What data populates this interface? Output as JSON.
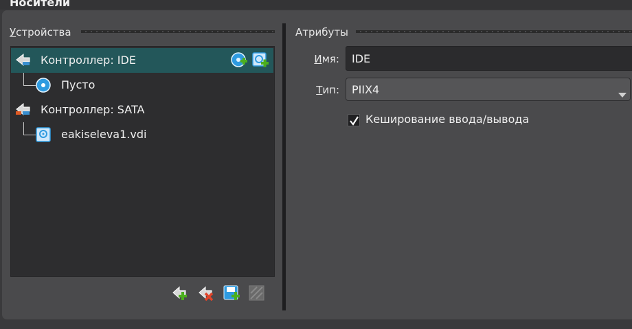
{
  "page_title": "Носители",
  "devices": {
    "title": "Устройства",
    "mnemonic": "У",
    "title_rest": "стройства",
    "items": [
      {
        "label": "Контроллер: IDE"
      },
      {
        "label": "Пусто"
      },
      {
        "label": "Контроллер: SATA"
      },
      {
        "label": "eakiseleva1.vdi"
      }
    ]
  },
  "attributes": {
    "title": "Атрибуты",
    "name_label_mnemonic": "И",
    "name_label_rest": "мя:",
    "name_value": "IDE",
    "type_label_mnemonic": "Т",
    "type_label_rest": "ип:",
    "type_value": "PIIX4",
    "cache_checked": true,
    "cache_label": "Кеширование ввода/вывода"
  },
  "icons": {
    "controller-ide": "controller-ide-icon",
    "add-optical": "add-optical-drive-icon",
    "add-hdd": "add-hard-disk-icon",
    "optical-disk": "optical-disk-icon",
    "controller-sata": "controller-sata-icon",
    "hard-disk": "hard-disk-icon",
    "add-controller": "add-controller-icon",
    "remove-controller": "remove-controller-icon",
    "add-attachment": "add-attachment-icon",
    "remove-attachment": "remove-attachment-icon"
  },
  "colors": {
    "selection": "#23575a",
    "accent_green": "#4caf1e",
    "accent_blue": "#2f9be0"
  }
}
